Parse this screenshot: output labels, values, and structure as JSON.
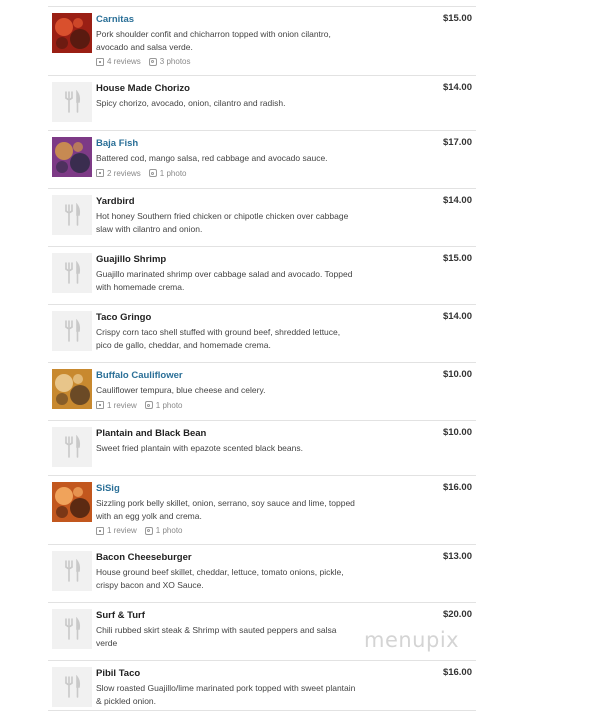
{
  "items": [
    {
      "name": "Carnitas",
      "linked": true,
      "desc": [
        "Pork shoulder confit and chicharron topped with onion cilantro,",
        "avocado and salsa verde."
      ],
      "reviews": "4 reviews",
      "photos": "3 photos",
      "price": "$15.00",
      "image": "photo",
      "palette": [
        "#9a1f14",
        "#d9502d",
        "#5a1a10"
      ]
    },
    {
      "name": "House Made Chorizo",
      "linked": false,
      "desc": [
        "Spicy chorizo, avocado, onion, cilantro and radish."
      ],
      "price": "$14.00",
      "image": "placeholder"
    },
    {
      "name": "Baja Fish",
      "linked": true,
      "desc": [
        "Battered cod, mango salsa, red cabbage and avocado sauce."
      ],
      "reviews": "2 reviews",
      "photos": "1 photo",
      "price": "$17.00",
      "image": "photo",
      "palette": [
        "#7d3a86",
        "#c78a52",
        "#3a2d4f"
      ]
    },
    {
      "name": "Yardbird",
      "linked": false,
      "desc": [
        "Hot honey Southern fried chicken or chipotle chicken over cabbage",
        "slaw with cilantro and onion."
      ],
      "price": "$14.00",
      "image": "placeholder"
    },
    {
      "name": "Guajillo Shrimp",
      "linked": false,
      "desc": [
        "Guajillo marinated shrimp over cabbage salad and avocado. Topped",
        "with homemade crema."
      ],
      "price": "$15.00",
      "image": "placeholder"
    },
    {
      "name": "Taco Gringo",
      "linked": false,
      "desc": [
        "Crispy corn taco shell stuffed with ground beef, shredded lettuce,",
        "pico de gallo, cheddar, and homemade crema."
      ],
      "price": "$14.00",
      "image": "placeholder"
    },
    {
      "name": "Buffalo Cauliflower",
      "linked": true,
      "desc": [
        "Cauliflower tempura, blue cheese and celery."
      ],
      "reviews": "1 review",
      "photos": "1 photo",
      "price": "$10.00",
      "image": "photo",
      "palette": [
        "#c8892f",
        "#e8c58a",
        "#6b4a26"
      ]
    },
    {
      "name": "Plantain and Black Bean",
      "linked": false,
      "desc": [
        "Sweet fried plantain with epazote scented black beans."
      ],
      "price": "$10.00",
      "image": "placeholder"
    },
    {
      "name": "SiSig",
      "linked": true,
      "desc": [
        "Sizzling pork belly skillet, onion, serrano, soy sauce and lime, topped",
        "with an egg yolk and crema."
      ],
      "reviews": "1 review",
      "photos": "1 photo",
      "price": "$16.00",
      "image": "photo",
      "palette": [
        "#c2571e",
        "#f0a35b",
        "#5c2a12"
      ]
    },
    {
      "name": "Bacon Cheeseburger",
      "linked": false,
      "desc": [
        "House ground beef skillet, cheddar, lettuce, tomato onions, pickle,",
        "crispy bacon and XO Sauce."
      ],
      "price": "$13.00",
      "image": "placeholder"
    },
    {
      "name": "Surf & Turf",
      "linked": false,
      "desc": [
        "Chili rubbed skirt steak & Shrimp with sauted peppers and salsa",
        "verde"
      ],
      "price": "$20.00",
      "image": "placeholder"
    },
    {
      "name": "Pibil Taco",
      "linked": false,
      "desc": [
        "Slow roasted Guajillo/lime marinated pork topped with sweet plantain",
        "& pickled onion."
      ],
      "price": "$16.00",
      "image": "placeholder"
    }
  ],
  "watermark": "menupix"
}
